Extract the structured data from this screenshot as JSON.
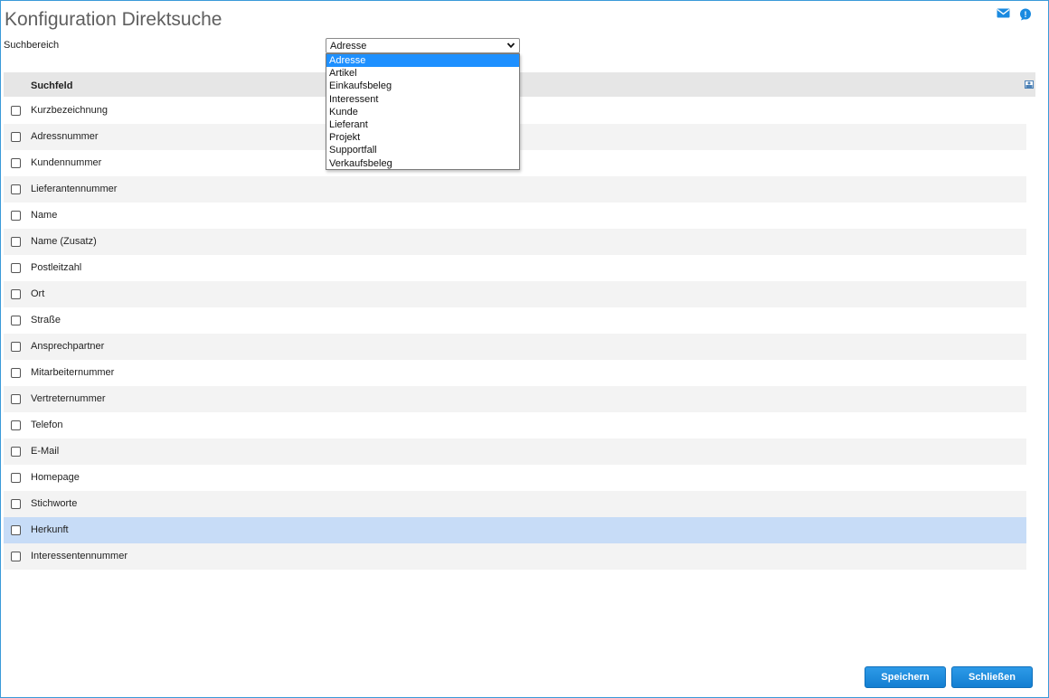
{
  "header": {
    "title": "Konfiguration Direktsuche",
    "icons": [
      "mail-icon",
      "help-icon"
    ]
  },
  "search_area": {
    "label": "Suchbereich",
    "selected": "Adresse",
    "options": [
      "Adresse",
      "Artikel",
      "Einkaufsbeleg",
      "Interessent",
      "Kunde",
      "Lieferant",
      "Projekt",
      "Supportfall",
      "Verkaufsbeleg"
    ]
  },
  "table": {
    "column_header": "Suchfeld",
    "rows": [
      {
        "label": "Kurzbezeichnung",
        "checked": false
      },
      {
        "label": "Adressnummer",
        "checked": false
      },
      {
        "label": "Kundennummer",
        "checked": false
      },
      {
        "label": "Lieferantennummer",
        "checked": false
      },
      {
        "label": "Name",
        "checked": false
      },
      {
        "label": "Name (Zusatz)",
        "checked": false
      },
      {
        "label": "Postleitzahl",
        "checked": false
      },
      {
        "label": "Ort",
        "checked": false
      },
      {
        "label": "Straße",
        "checked": false
      },
      {
        "label": "Ansprechpartner",
        "checked": false
      },
      {
        "label": "Mitarbeiternummer",
        "checked": false
      },
      {
        "label": "Vertreternummer",
        "checked": false
      },
      {
        "label": "Telefon",
        "checked": false
      },
      {
        "label": "E-Mail",
        "checked": false
      },
      {
        "label": "Homepage",
        "checked": false
      },
      {
        "label": "Stichworte",
        "checked": false
      },
      {
        "label": "Herkunft",
        "checked": false
      },
      {
        "label": "Interessentennummer",
        "checked": false
      }
    ],
    "highlighted_row": "Herkunft"
  },
  "footer": {
    "save_label": "Speichern",
    "close_label": "Schließen"
  },
  "colors": {
    "accent": "#1e90ff",
    "button": "#1a8ae0",
    "row_highlight": "#c7dcf7",
    "frame_border": "#3a9ad9"
  }
}
